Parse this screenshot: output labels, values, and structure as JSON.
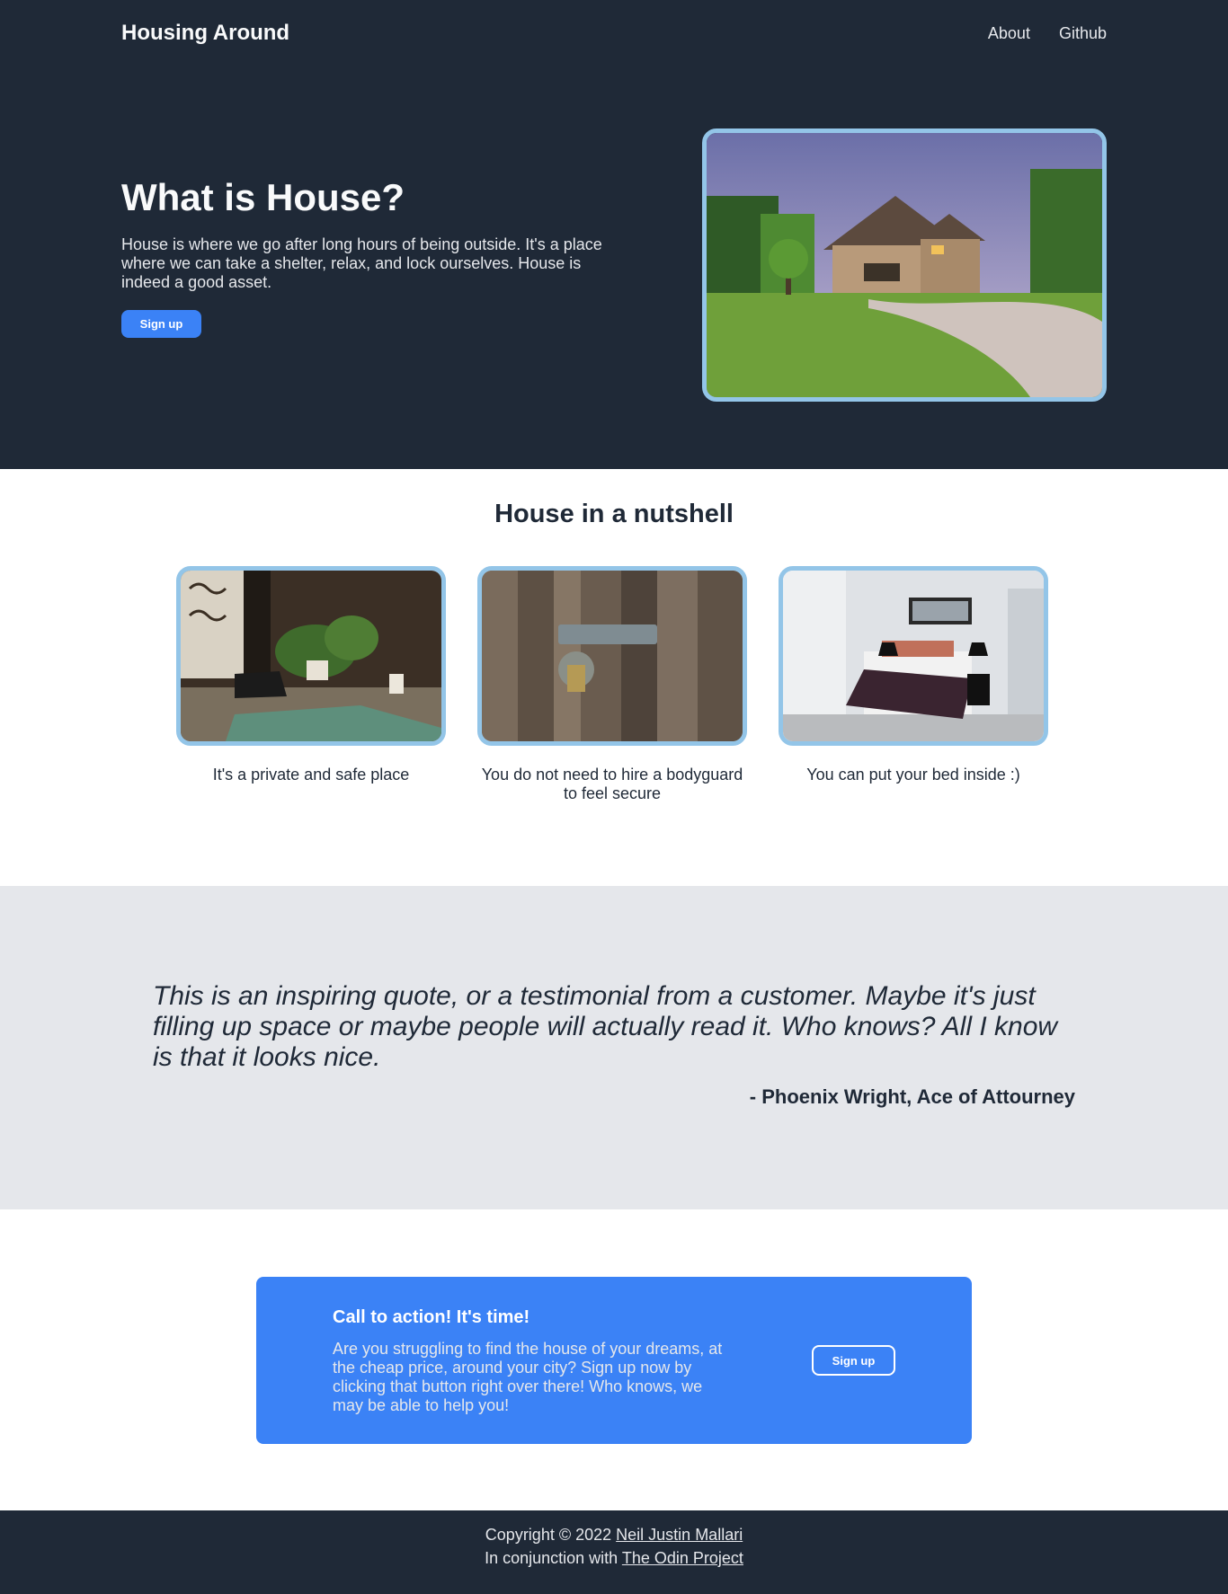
{
  "header": {
    "brand": "Housing Around",
    "links": [
      "About",
      "Github"
    ]
  },
  "hero": {
    "title": "What is House?",
    "description": "House is where we go after long hours of being outside. It's a place where we can take a shelter, relax, and lock ourselves. House is indeed a good asset.",
    "signup_label": "Sign up",
    "image_icon": "house-photo"
  },
  "nutshell": {
    "title": "House in a nutshell",
    "cards": [
      {
        "caption": "It's a private and safe place",
        "image_icon": "living-room-photo"
      },
      {
        "caption": "You do not need to hire a bodyguard to feel secure",
        "image_icon": "padlock-door-photo"
      },
      {
        "caption": "You can put your bed inside :)",
        "image_icon": "bedroom-photo"
      }
    ]
  },
  "quote": {
    "text": "This is an inspiring quote, or a testimonial from a customer. Maybe it's just filling up space or maybe people will actually read it. Who knows? All I know is that it looks nice.",
    "author": "- Phoenix Wright, Ace of Attourney"
  },
  "cta": {
    "title": "Call to action! It's time!",
    "description": "Are you struggling to find the house of your dreams, at the cheap price, around your city? Sign up now by clicking that button right over there! Who knows, we may be able to help you!",
    "signup_label": "Sign up"
  },
  "footer": {
    "copyright_prefix": "Copyright © 2022",
    "author_link": "Neil Justin Mallari",
    "conjunction_prefix": "In conjunction with",
    "project_link": "The Odin Project"
  },
  "colors": {
    "dark": "#1f2937",
    "accent": "#3b82f6",
    "image_border": "#93c5e8",
    "quote_bg": "#e5e7eb"
  }
}
